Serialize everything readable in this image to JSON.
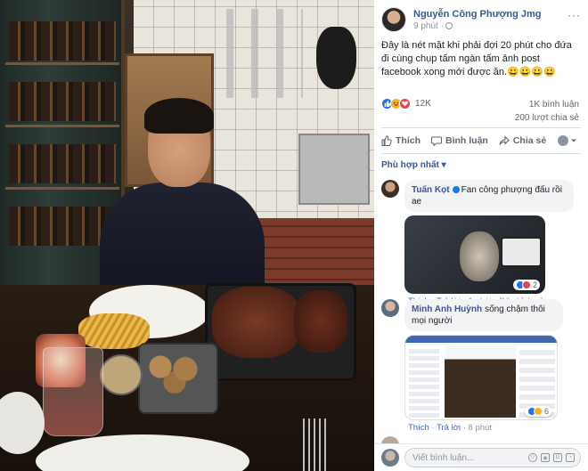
{
  "post": {
    "author": "Nguyễn Công Phượng Jmg",
    "time": "9 phút ·",
    "more": "···",
    "caption": "Đây là nét mặt khi phải đợi 20 phút cho đứa đi cùng chụp tấm ngàn tấm ảnh post facebook xong mới được ăn.😀😀😀😀",
    "reaction_count": "12K",
    "comments_count": "1K bình luận",
    "shares_count": "200 lượt chia sẻ",
    "actions": {
      "like": "Thích",
      "comment": "Bình luận",
      "share": "Chia sẻ"
    }
  },
  "comments_filter": "Phù hợp nhất ▾",
  "comments": [
    {
      "name": "Tuấn Kọt",
      "text": "Fan công phượng đấu rồi ae",
      "like": "Thích",
      "reply": "Trả lời",
      "meta": "· 1 phút · Đã chỉnh sửa",
      "image_reaction_count": "2"
    },
    {
      "name": "Minh Anh Huỳnh",
      "text": "sống chậm thôi mọi người",
      "like": "Thích",
      "reply": "Trả lời",
      "meta": "· 8 phút",
      "image_reaction_count": "6"
    }
  ],
  "composer": {
    "placeholder": "Viết bình luận...",
    "icons": [
      "emoji-icon",
      "camera-icon",
      "gif-icon",
      "sticker-icon"
    ]
  },
  "colors": {
    "link": "#385898",
    "meta_link": "#4267b2",
    "like_blue": "#1877f2",
    "love_red": "#f33e58",
    "haha_yellow": "#f7b125"
  }
}
